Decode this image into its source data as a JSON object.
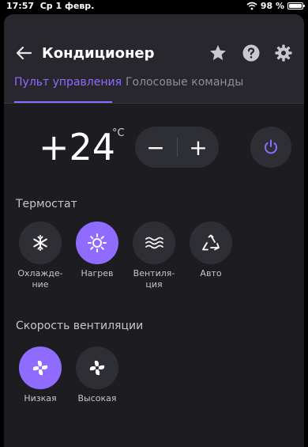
{
  "status": {
    "time": "17:57",
    "date": "Ср 1 февр.",
    "battery": "98 %",
    "battery_level": 0.98
  },
  "header": {
    "title": "Кондиционер"
  },
  "tabs": [
    {
      "label": "Пульт управления",
      "active": true
    },
    {
      "label": "Голосовые команды",
      "active": false
    }
  ],
  "control": {
    "temperature": "+24",
    "unit": "°C",
    "minus": "−",
    "plus": "+"
  },
  "thermostat": {
    "title": "Термостат",
    "modes": [
      {
        "label": "Охлажде-\nние",
        "icon": "snowflake-icon",
        "active": false
      },
      {
        "label": "Нагрев",
        "icon": "sun-icon",
        "active": true
      },
      {
        "label": "Вентиля-\nция",
        "icon": "wave-icon",
        "active": false
      },
      {
        "label": "Авто",
        "icon": "recycle-icon",
        "active": false
      }
    ]
  },
  "fan": {
    "title": "Скорость вентиляции",
    "modes": [
      {
        "label": "Низкая",
        "icon": "fan-icon",
        "active": true
      },
      {
        "label": "Высокая",
        "icon": "fan-icon",
        "active": false
      }
    ]
  },
  "colors": {
    "accent": "#8f6bff",
    "panel": "#1c1c21",
    "header": "#27272d",
    "button": "#2e2e35"
  }
}
